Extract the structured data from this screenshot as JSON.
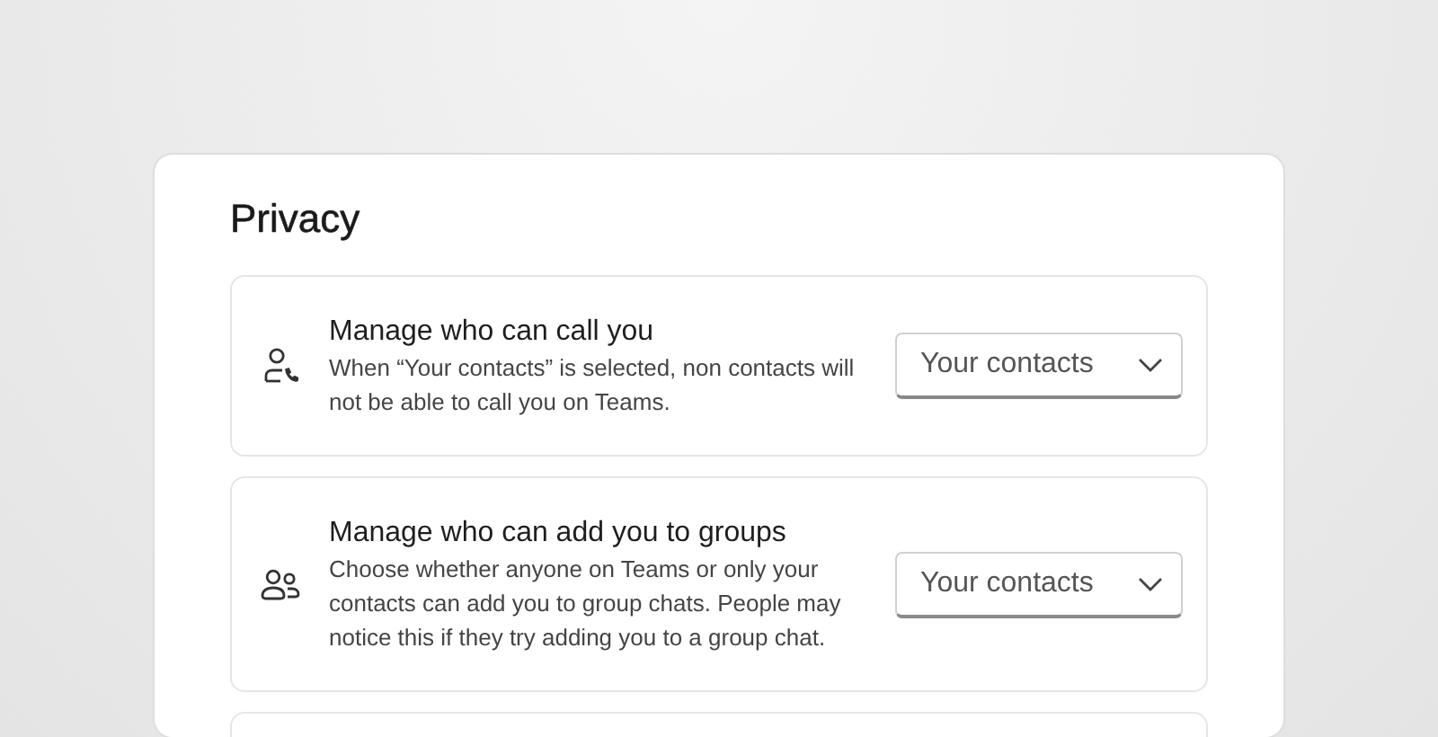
{
  "panel": {
    "title": "Privacy"
  },
  "settings": [
    {
      "kind": "call",
      "title": "Manage who can call you",
      "description": "When “Your contacts” is selected, non contacts will not be able to call you on Teams.",
      "dropdown": "Your contacts"
    },
    {
      "kind": "group",
      "title": "Manage who can add you to groups",
      "description": "Choose whether anyone on Teams or only your contacts can add you to group chats. People may notice this if they try adding you to a group chat.",
      "dropdown": "Your contacts"
    }
  ]
}
